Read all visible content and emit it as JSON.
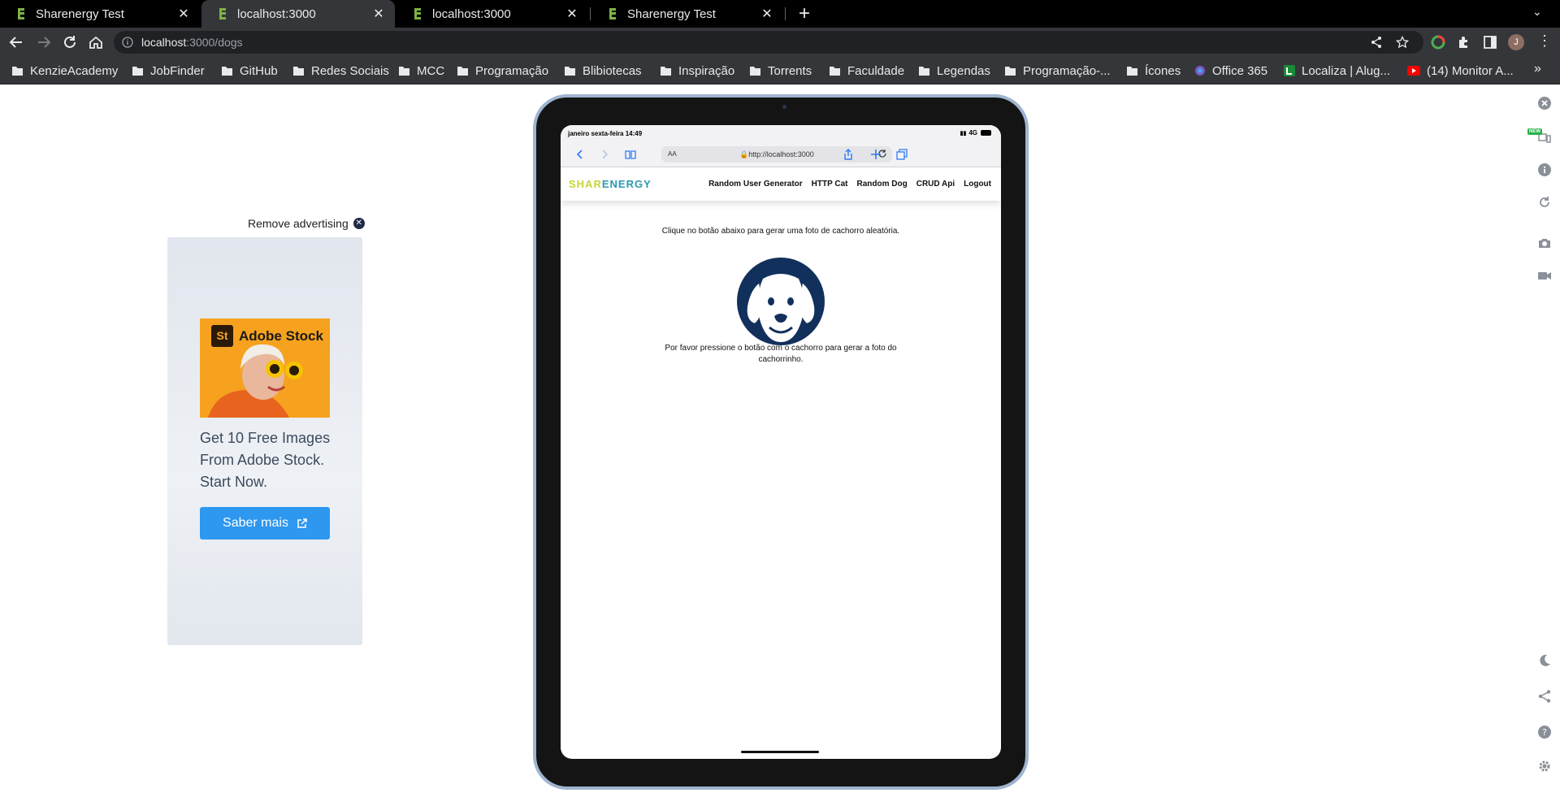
{
  "tabs": [
    {
      "title": "Sharenergy Test",
      "active": false
    },
    {
      "title": "localhost:3000",
      "active": true
    },
    {
      "title": "localhost:3000",
      "active": false
    },
    {
      "title": "Sharenergy Test",
      "active": false
    }
  ],
  "toolbar": {
    "url_host": "localhost",
    "url_path": ":3000/dogs"
  },
  "bookmarks": [
    {
      "label": "KenzieAcademy",
      "icon": "folder-icon"
    },
    {
      "label": "JobFinder",
      "icon": "folder-icon"
    },
    {
      "label": "GitHub",
      "icon": "folder-icon"
    },
    {
      "label": "Redes Sociais",
      "icon": "folder-icon"
    },
    {
      "label": "MCC",
      "icon": "folder-icon"
    },
    {
      "label": "Programação",
      "icon": "folder-icon"
    },
    {
      "label": "Blibiotecas",
      "icon": "folder-icon"
    },
    {
      "label": "Inspiração",
      "icon": "folder-icon"
    },
    {
      "label": "Torrents",
      "icon": "folder-icon"
    },
    {
      "label": "Faculdade",
      "icon": "folder-icon"
    },
    {
      "label": "Legendas",
      "icon": "folder-icon"
    },
    {
      "label": "Programação-...",
      "icon": "folder-icon"
    },
    {
      "label": "Ícones",
      "icon": "folder-icon"
    },
    {
      "label": "Office 365",
      "icon": "office-icon"
    },
    {
      "label": "Localiza | Alug...",
      "icon": "localiza-icon"
    },
    {
      "label": "(14) Monitor A...",
      "icon": "youtube-icon"
    }
  ],
  "ad": {
    "remove_label": "Remove advertising",
    "brand_short": "St",
    "brand": "Adobe Stock",
    "text": "Get 10 Free Images From Adobe Stock. Start Now.",
    "button": "Saber mais"
  },
  "device": {
    "status_time": "janeiro sexta-feira 14:49",
    "status_network": "4G",
    "safari_aa": "AA",
    "safari_url": "http://localhost:3000",
    "logo_part1": "SHAR",
    "logo_part2": "ENERGY",
    "nav": [
      "Random User Generator",
      "HTTP Cat",
      "Random Dog",
      "CRUD Api",
      "Logout"
    ],
    "instruction": "Clique no botão abaixo para gerar uma foto de cachorro aleatória.",
    "hint": "Por favor pressione o botão com o cachorro para gerar a foto do cachorrinho."
  },
  "sidebar_badge": "NEW",
  "colors": {
    "accent_blue": "#2e97ef",
    "logo_green": "#c8d43a",
    "logo_teal": "#2a9ab0",
    "dog_navy": "#12305c"
  }
}
